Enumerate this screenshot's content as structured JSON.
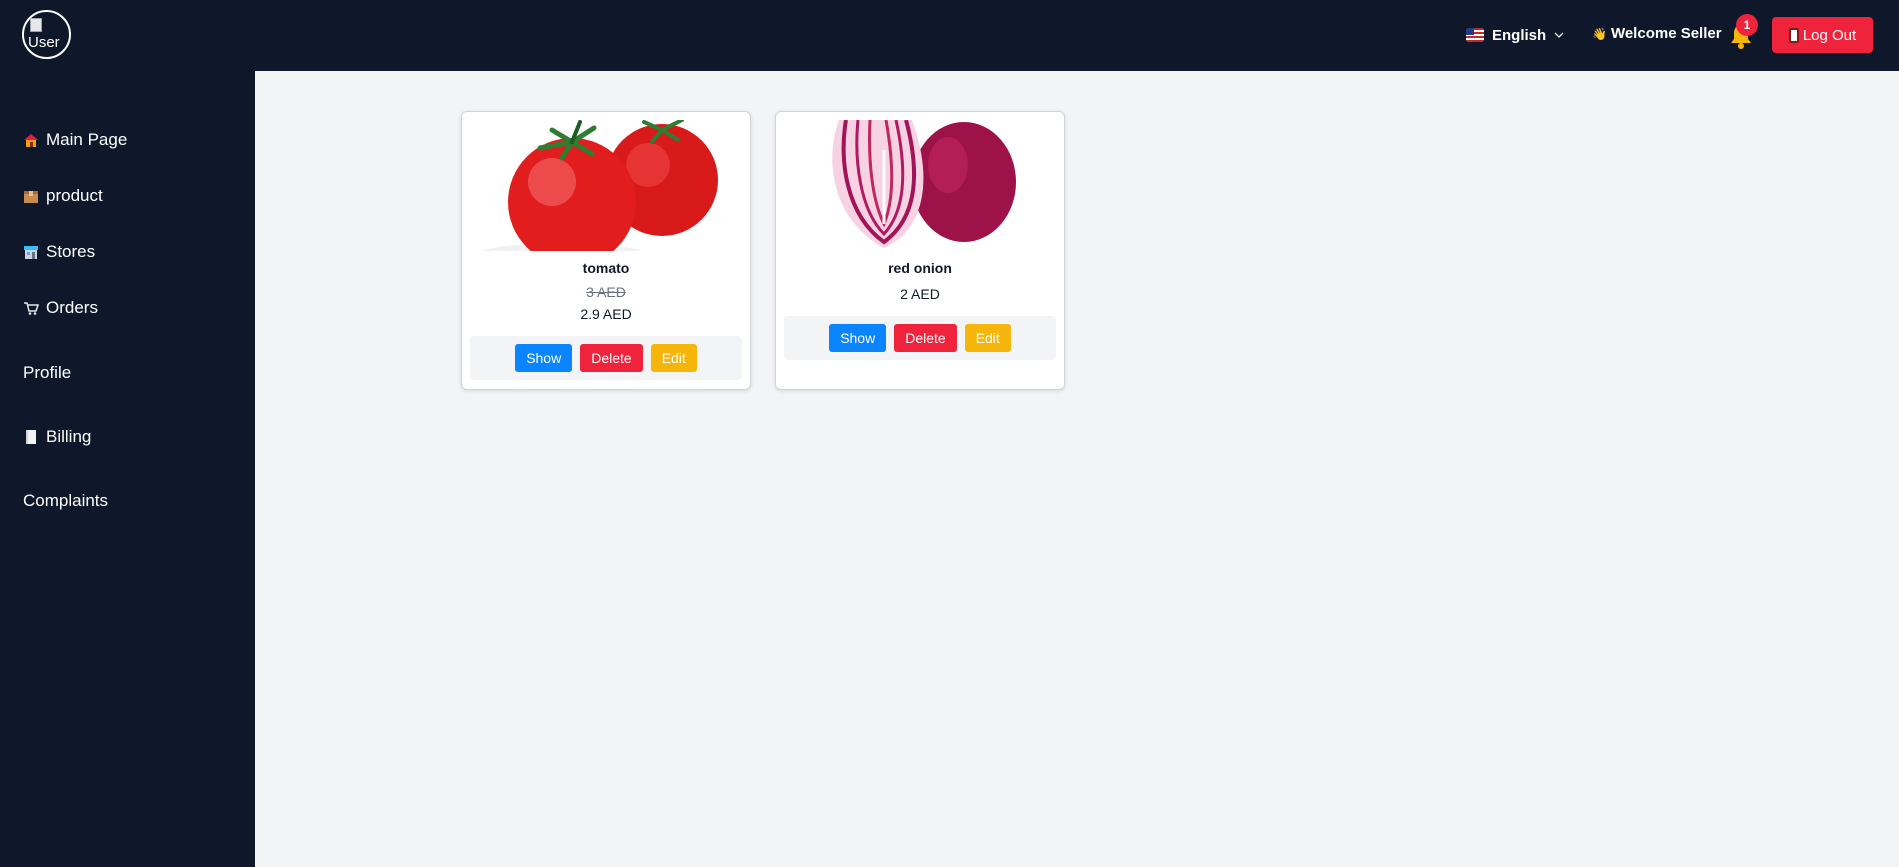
{
  "header": {
    "avatar_alt": "User",
    "language": "English",
    "welcome": "Welcome Seller",
    "welcome_emoji": "👋",
    "notification_count": "1",
    "logout_label": "Log Out"
  },
  "sidebar": {
    "items": [
      {
        "label": "Main Page",
        "icon": "home-icon"
      },
      {
        "label": "product",
        "icon": "package-icon"
      },
      {
        "label": "Stores",
        "icon": "store-icon"
      },
      {
        "label": "Orders",
        "icon": "cart-icon"
      },
      {
        "label": "Profile",
        "icon": ""
      },
      {
        "label": "Billing",
        "icon": "receipt-icon"
      },
      {
        "label": "Complaints",
        "icon": ""
      }
    ]
  },
  "products": [
    {
      "name": "tomato",
      "old_price": "3 AED",
      "price": "2.9 AED",
      "image": "tomato-image"
    },
    {
      "name": "red onion",
      "old_price": "",
      "price": "2 AED",
      "image": "red-onion-image"
    }
  ],
  "actions": {
    "show": "Show",
    "delete": "Delete",
    "edit": "Edit"
  },
  "colors": {
    "sidebar_bg": "#0f172a",
    "page_bg": "#f3f4f6",
    "danger": "#ef233c",
    "primary": "#0a84ff",
    "warning": "#f5b50a"
  }
}
